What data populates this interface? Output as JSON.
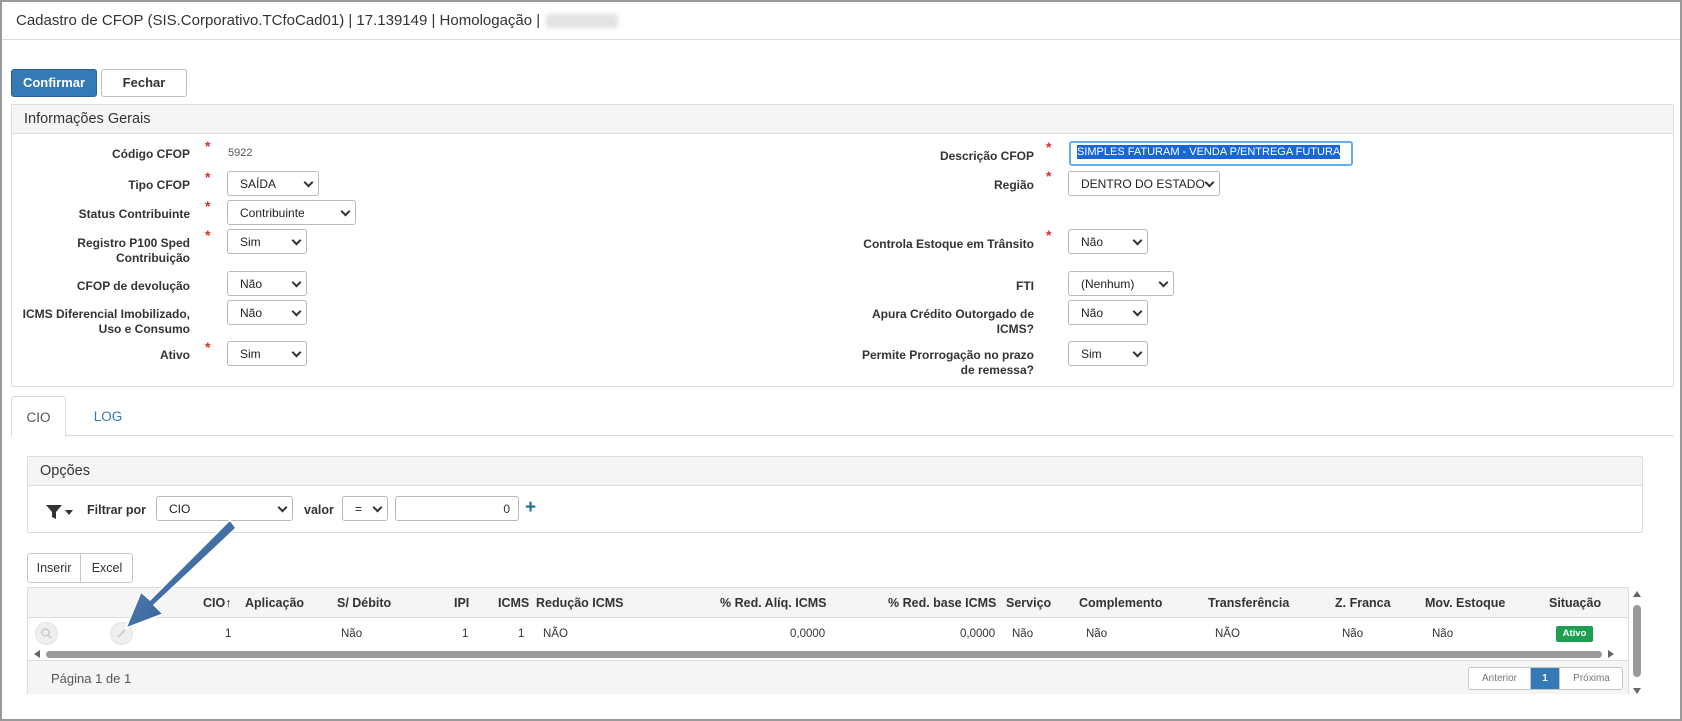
{
  "window": {
    "title": "Cadastro de CFOP (SIS.Corporativo.TCfoCad01) | 17.139149 | Homologação |"
  },
  "toolbar": {
    "confirm_label": "Confirmar",
    "close_label": "Fechar"
  },
  "geral": {
    "panel_title": "Informações Gerais",
    "codigo_label": "Código CFOP",
    "codigo_value": "5922",
    "tipo_label": "Tipo CFOP",
    "tipo_value": "SAÍDA",
    "status_label": "Status Contribuinte",
    "status_value": "Contribuinte",
    "registro_label_1": "Registro P100 Sped",
    "registro_label_2": "Contribuição",
    "registro_value": "Sim",
    "devolucao_label": "CFOP de devolução",
    "devolucao_value": "Não",
    "icms_dif_label_1": "ICMS Diferencial Imobilizado,",
    "icms_dif_label_2": "Uso e Consumo",
    "icms_dif_value": "Não",
    "ativo_label": "Ativo",
    "ativo_value": "Sim",
    "descricao_label": "Descrição CFOP",
    "descricao_value": "SIMPLES FATURAM - VENDA P/ENTREGA FUTURA",
    "regiao_label": "Região",
    "regiao_value": "DENTRO DO ESTADO",
    "estoque_label": "Controla Estoque em Trânsito",
    "estoque_value": "Não",
    "fti_label": "FTI",
    "fti_value": "(Nenhum)",
    "apura_label_1": "Apura Crédito Outorgado de",
    "apura_label_2": "ICMS?",
    "apura_value": "Não",
    "prorrogacao_label_1": "Permite Prorrogação no prazo",
    "prorrogacao_label_2": "de remessa?",
    "prorrogacao_value": "Sim"
  },
  "tabs": [
    {
      "label": "CIO"
    },
    {
      "label": "LOG"
    }
  ],
  "opcoes": {
    "panel_title": "Opções",
    "filter_label": "Filtrar por",
    "filter_field": "CIO",
    "valor_label": "valor",
    "operator": "=",
    "filter_value": "0"
  },
  "grid_toolbar": {
    "insert_label": "Inserir",
    "excel_label": "Excel"
  },
  "grid": {
    "columns": [
      "CIO",
      "Aplicação",
      "S/ Débito",
      "IPI",
      "ICMS",
      "Redução ICMS",
      "% Red. Alíq. ICMS",
      "% Red. base ICMS",
      "Serviço",
      "Complemento",
      "Transferência",
      "Z. Franca",
      "Mov. Estoque",
      "Situação"
    ],
    "sort_indicator": "↑",
    "rows": [
      {
        "cio": "1",
        "aplicacao": "",
        "sdebito": "Não",
        "ipi": "1",
        "icms": "1",
        "reducao": "NÃO",
        "red_aliq": "0,0000",
        "red_base": "0,0000",
        "servico": "Não",
        "complemento": "Não",
        "transferencia": "NÃO",
        "zfranca": "Não",
        "mov_estoque": "Não",
        "situacao": "Ativo"
      }
    ],
    "page_info": "Página 1 de 1",
    "prev_label": "Anterior",
    "current_page": "1",
    "next_label": "Próxima"
  },
  "colors": {
    "primary": "#337ab7",
    "required": "#d9302c",
    "status_active": "#1e9e50",
    "annotation_arrow": "#1d4f8a"
  }
}
